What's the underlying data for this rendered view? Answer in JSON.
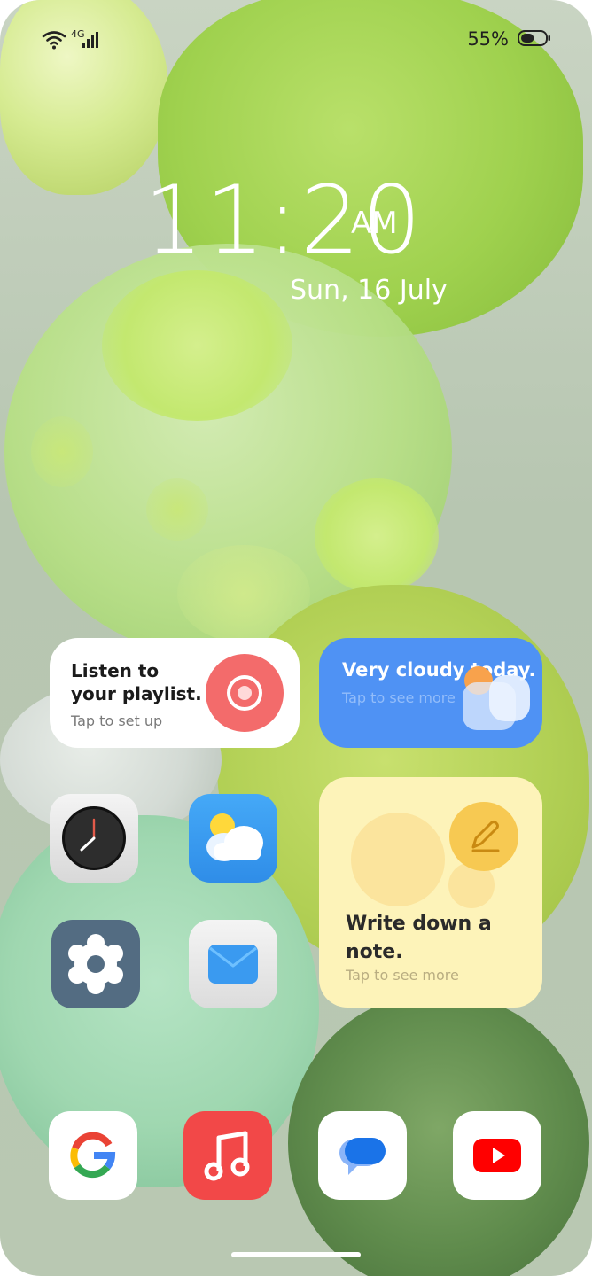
{
  "status_bar": {
    "network": "4G",
    "battery_percent": "55%",
    "battery_level": 0.55
  },
  "clock": {
    "time": "11:20",
    "ampm": "AM",
    "date": "Sun, 16 July"
  },
  "widgets": {
    "music": {
      "title": "Listen to your playlist.",
      "subtitle": "Tap to set up"
    },
    "weather": {
      "title": "Very cloudy today.",
      "subtitle": "Tap to see more"
    },
    "notes": {
      "title": "Write down a note.",
      "subtitle": "Tap to see more"
    }
  },
  "apps": [
    {
      "icon": "clock-icon"
    },
    {
      "icon": "weather-icon"
    },
    {
      "icon": "settings-icon"
    },
    {
      "icon": "mail-icon"
    }
  ],
  "dock": [
    {
      "icon": "google-icon"
    },
    {
      "icon": "music-icon"
    },
    {
      "icon": "messages-icon"
    },
    {
      "icon": "youtube-icon"
    }
  ],
  "colors": {
    "weather_widget": "#4f92f4",
    "note_widget": "#fdf3b9",
    "record_button": "#f36b6b",
    "music_app": "#f24848",
    "settings_app": "#536c82"
  }
}
